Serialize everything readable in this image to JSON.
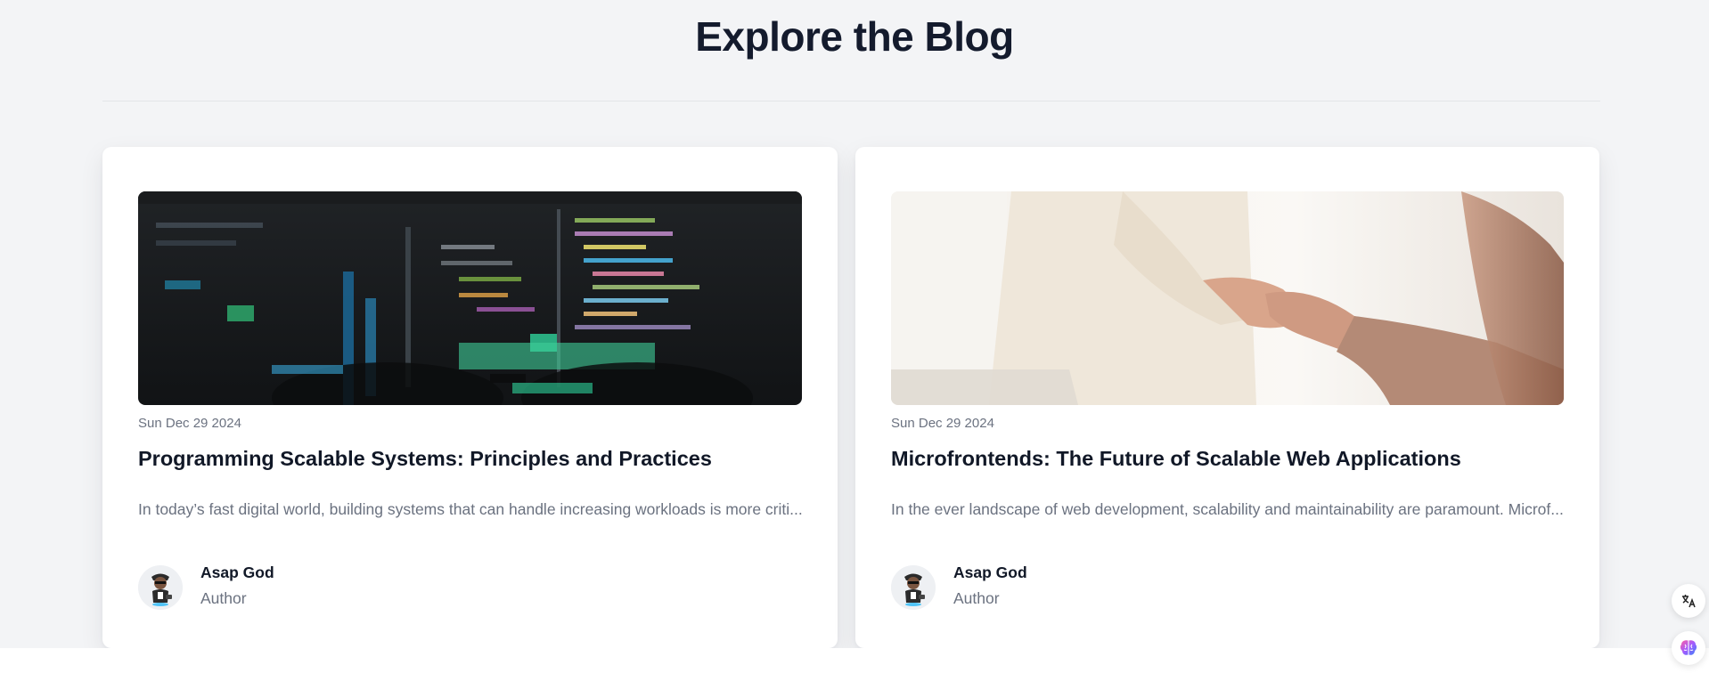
{
  "page": {
    "title": "Explore the Blog"
  },
  "posts": [
    {
      "date": "Sun Dec 29 2024",
      "title": "Programming Scalable Systems: Principles and Practices",
      "excerpt": "In today’s fast digital world, building systems that can handle increasing workloads is more criti...",
      "author": {
        "name": "Asap God",
        "role": "Author"
      }
    },
    {
      "date": "Sun Dec 29 2024",
      "title": "Microfrontends: The Future of Scalable Web Applications",
      "excerpt": "In the ever landscape of web development, scalability and maintainability are paramount. Microf...",
      "author": {
        "name": "Asap God",
        "role": "Author"
      }
    }
  ],
  "floating_buttons": [
    {
      "icon": "translate-icon"
    },
    {
      "icon": "brain-icon"
    }
  ]
}
